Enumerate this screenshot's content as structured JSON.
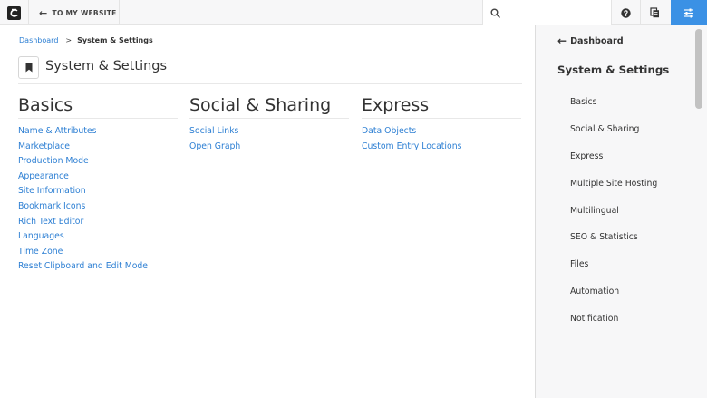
{
  "toolbar": {
    "logo_icon": "concrete-cms-logo-icon",
    "back_label": "TO MY WEBSITE",
    "search_placeholder": "",
    "accent_color": "#3b91e5"
  },
  "breadcrumb": {
    "parent": "Dashboard",
    "separator": ">",
    "current": "System & Settings"
  },
  "page": {
    "title": "System & Settings"
  },
  "sections": [
    {
      "title": "Basics",
      "links": [
        "Name & Attributes",
        "Marketplace",
        "Production Mode",
        "Appearance",
        "Site Information",
        "Bookmark Icons",
        "Rich Text Editor",
        "Languages",
        "Time Zone",
        "Reset Clipboard and Edit Mode"
      ]
    },
    {
      "title": "Social & Sharing",
      "links": [
        "Social Links",
        "Open Graph"
      ]
    },
    {
      "title": "Express",
      "links": [
        "Data Objects",
        "Custom Entry Locations"
      ]
    }
  ],
  "side_panel": {
    "back_label": "Dashboard",
    "title": "System & Settings",
    "items": [
      "Basics",
      "Social & Sharing",
      "Express",
      "Multiple Site Hosting",
      "Multilingual",
      "SEO & Statistics",
      "Files",
      "Automation",
      "Notification"
    ]
  }
}
